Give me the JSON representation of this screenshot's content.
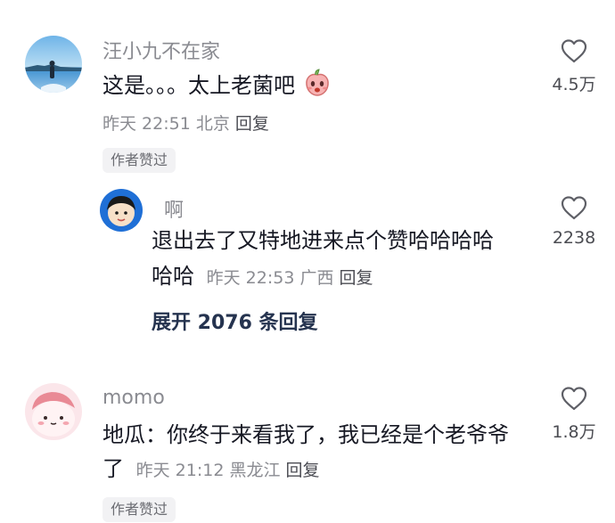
{
  "comments": [
    {
      "username": "汪小九不在家",
      "text": "这是。。。太上老菌吧",
      "emoji_icon": "peach-face-emoji",
      "time": "昨天 22:51",
      "location": "北京",
      "reply_label": "回复",
      "badge": "作者赞过",
      "likes": "4.5万",
      "reply": {
        "username": "啊",
        "text_line1": "退出去了又特地进来点个赞哈哈哈哈",
        "text_line2": "哈哈",
        "time": "昨天 22:53",
        "location": "广西",
        "reply_label": "回复",
        "likes": "2238"
      },
      "expand_label": "展开 2076 条回复"
    },
    {
      "username": "momo",
      "text_line1": "地瓜：你终于来看我了，我已经是个老爷爷",
      "text_line2": "了",
      "time": "昨天 21:12",
      "location": "黑龙江",
      "reply_label": "回复",
      "badge": "作者赞过",
      "likes": "1.8万"
    }
  ]
}
